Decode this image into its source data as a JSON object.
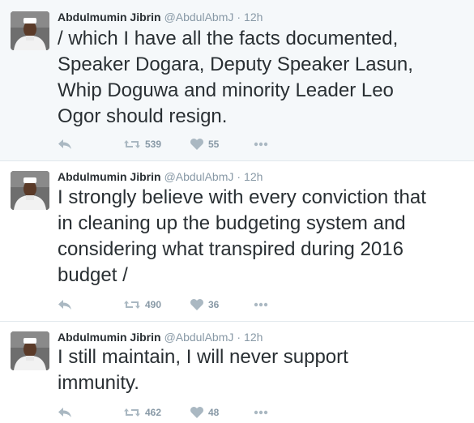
{
  "tweets": [
    {
      "author": "Abdulmumin Jibrin",
      "handle": "@AbdulAbmJ",
      "separator": "·",
      "time": "12h",
      "text": "/ which I have all the facts documented,\nSpeaker Dogara, Deputy Speaker Lasun,\nWhip Doguwa and minority Leader Leo\nOgor should resign.",
      "retweets": "539",
      "likes": "55"
    },
    {
      "author": "Abdulmumin Jibrin",
      "handle": "@AbdulAbmJ",
      "separator": "·",
      "time": "12h",
      "text": "I strongly believe with every conviction that\nin cleaning up the budgeting system and\nconsidering what transpired during 2016\nbudget /",
      "retweets": "490",
      "likes": "36"
    },
    {
      "author": "Abdulmumin Jibrin",
      "handle": "@AbdulAbmJ",
      "separator": "·",
      "time": "12h",
      "text": "I still maintain, I will never support\nimmunity.",
      "retweets": "462",
      "likes": "48"
    }
  ],
  "icons": {
    "reply": "reply-icon",
    "retweet": "retweet-icon",
    "like": "heart-icon",
    "more": "more-icon"
  },
  "colors": {
    "icon": "#aab8c2",
    "name": "#292f33",
    "meta": "#8899a6",
    "highlight_bg": "#f5f8fa"
  }
}
